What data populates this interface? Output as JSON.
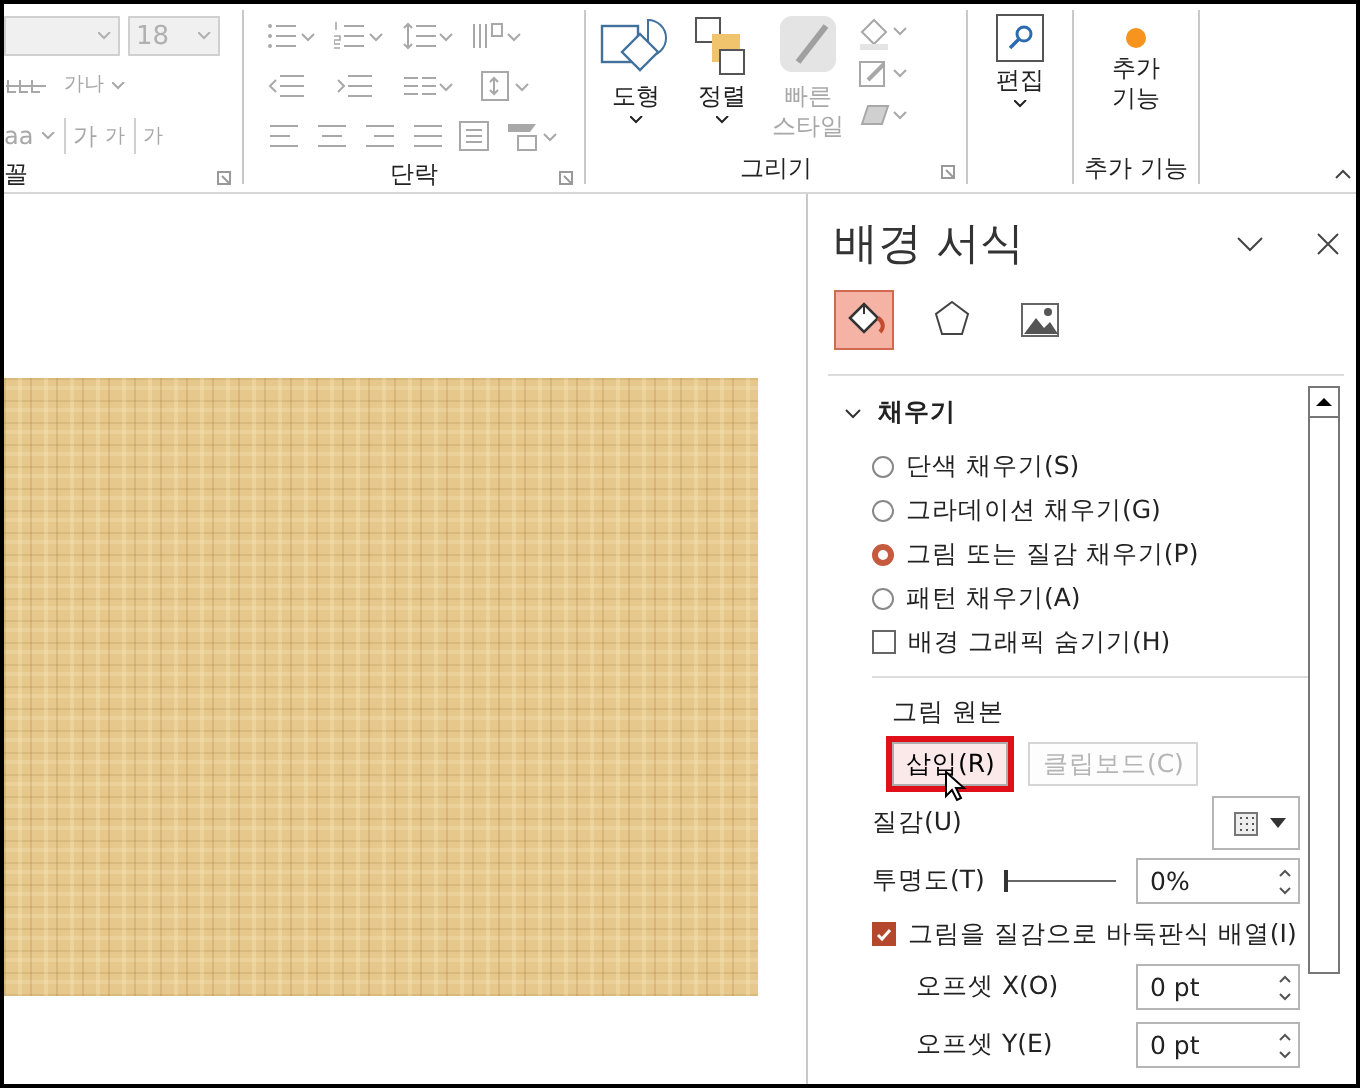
{
  "ribbon": {
    "font": {
      "size": "18",
      "spacing": "가나",
      "change_case": "aa",
      "grow": "가",
      "shrink": "가",
      "clear": "가",
      "label": "꼴",
      "disabled": true
    },
    "paragraph": {
      "label": "단락",
      "disabled": true
    },
    "drawing": {
      "buttons": [
        {
          "label": "도형",
          "disabled": false
        },
        {
          "label": "정렬",
          "disabled": false
        },
        {
          "label": "빠른 스타일",
          "disabled": true
        }
      ],
      "label": "그리기"
    },
    "editing": {
      "button": "편집"
    },
    "addins": {
      "button": "추가 기능",
      "label": "추가 기능"
    }
  },
  "pane": {
    "title": "배경 서식",
    "tabs": [
      {
        "selected": true
      },
      {
        "selected": false
      },
      {
        "selected": false
      }
    ],
    "section": {
      "title": "채우기",
      "expanded": true
    },
    "fill_options": [
      {
        "label": "단색 채우기(S)",
        "selected": false
      },
      {
        "label": "그라데이션 채우기(G)",
        "selected": false
      },
      {
        "label": "그림 또는 질감 채우기(P)",
        "selected": true
      },
      {
        "label": "패턴 채우기(A)",
        "selected": false
      }
    ],
    "hide_graphics": {
      "label": "배경 그래픽 숨기기(H)",
      "checked": false
    },
    "source": {
      "label": "그림 원본",
      "buttons": [
        {
          "label": "삽입(R)",
          "disabled": false,
          "highlighted": true
        },
        {
          "label": "클립보드(C)",
          "disabled": true,
          "highlighted": false
        }
      ]
    },
    "texture": {
      "label": "질감(U)"
    },
    "transparency": {
      "label": "투명도(T)",
      "level": 0,
      "value": "0%"
    },
    "tile": {
      "label": "그림을 질감으로 바둑판식 배열(I)",
      "checked": true
    },
    "offsets": [
      {
        "label": "오프셋 X(O)",
        "value": "0 pt"
      },
      {
        "label": "오프셋 Y(E)",
        "value": "0 pt"
      }
    ]
  }
}
